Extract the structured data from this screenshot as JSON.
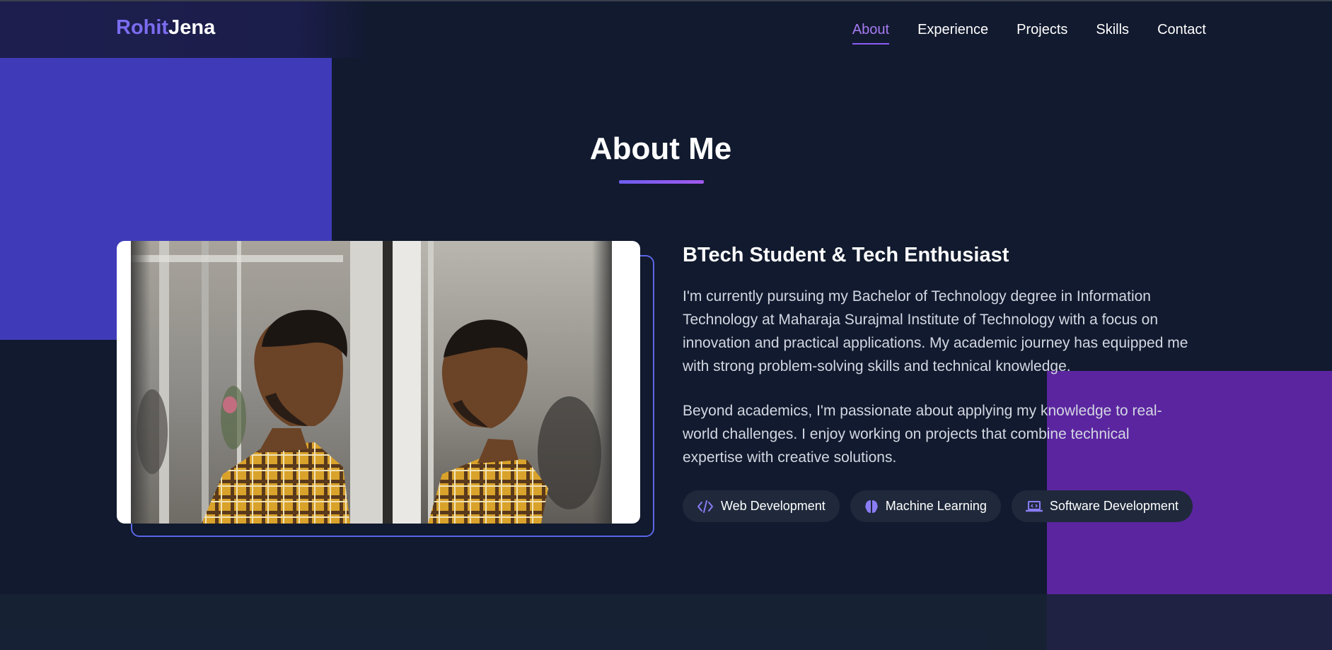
{
  "nav": {
    "logo_first": "Rohit",
    "logo_last": "Jena",
    "links": [
      "About",
      "Experience",
      "Projects",
      "Skills",
      "Contact"
    ],
    "active": "About"
  },
  "about": {
    "title": "About Me",
    "subtitle": "BTech Student & Tech Enthusiast",
    "paragraphs": [
      "I'm currently pursuing my Bachelor of Technology degree in Information Technology at Maharaja Surajmal Institute of Technology with a focus on innovation and practical applications. My academic journey has equipped me with strong problem-solving skills and technical knowledge.",
      "Beyond academics, I'm passionate about applying my knowledge to real-world challenges. I enjoy working on projects that combine technical expertise with creative solutions."
    ],
    "tags": [
      {
        "label": "Web Development",
        "icon": "code-icon"
      },
      {
        "label": "Machine Learning",
        "icon": "brain-icon"
      },
      {
        "label": "Software Development",
        "icon": "laptop-code-icon"
      }
    ],
    "photo": "profile-photo"
  },
  "colors": {
    "accent": "#7b6cf0",
    "active_link": "#a77bf3",
    "background": "#111a2e",
    "blob_indigo": "#3f3bb8",
    "blob_purple": "#5b25a0",
    "tag_bg": "#1f293b"
  }
}
